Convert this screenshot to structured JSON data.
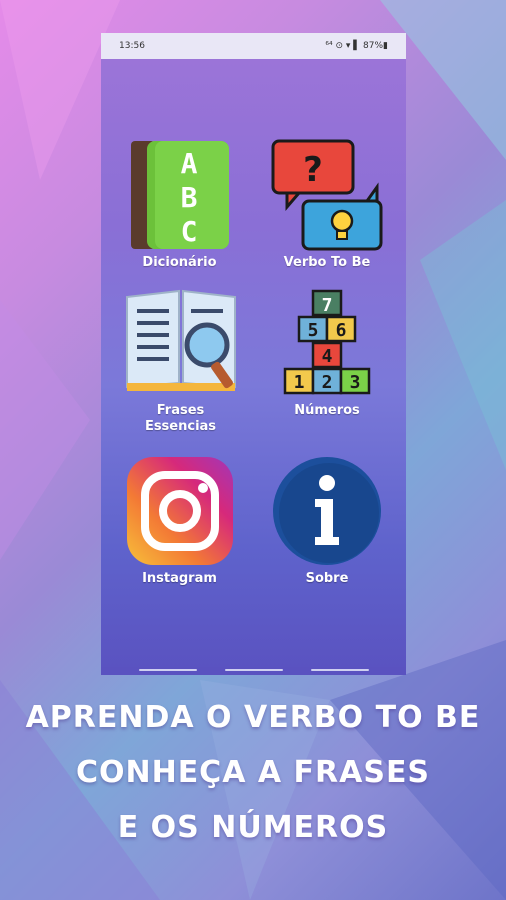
{
  "status_bar": {
    "time": "13:56",
    "indicators": "⁶⁴ ⊙ ▾ ▌ 87%▮"
  },
  "menu": {
    "dicionario": "Dicionário",
    "verbo": "Verbo To Be",
    "frases_line1": "Frases",
    "frases_line2": "Essencias",
    "numeros": "Números",
    "instagram": "Instagram",
    "sobre": "Sobre"
  },
  "abc_icon": {
    "letters": [
      "A",
      "B",
      "C"
    ]
  },
  "numbers_icon": {
    "digits": [
      "7",
      "5",
      "6",
      "4",
      "1",
      "2",
      "3"
    ]
  },
  "promo": {
    "line1": "APRENDA O VERBO TO BE",
    "line2": "CONHEÇA A FRASES",
    "line3": "E OS NÚMEROS"
  },
  "colors": {
    "book_green": "#6cc13a",
    "instagram_orange": "#f7a53a",
    "instagram_pink": "#d6297b",
    "info_blue": "#1c4f9c",
    "bubble_red": "#e8473c",
    "bubble_blue": "#3da4dc"
  }
}
